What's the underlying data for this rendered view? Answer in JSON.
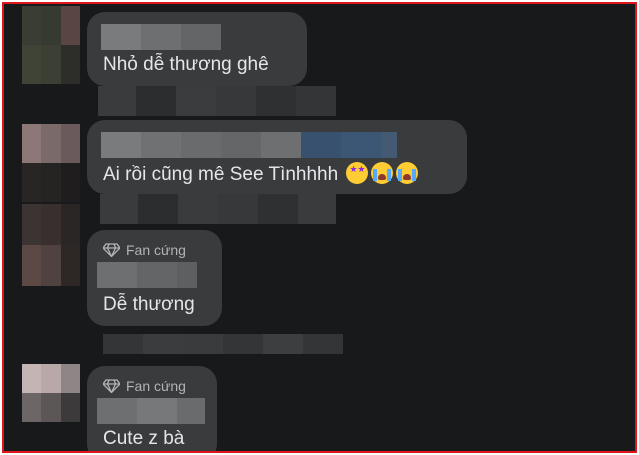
{
  "comments": [
    {
      "text": "Nhỏ dễ thương ghê",
      "badge": ""
    },
    {
      "text": "Ai rồi cũng mê See Tìnhhhh",
      "badge": ""
    },
    {
      "text": "Dễ thương",
      "badge": "Fan cứng"
    },
    {
      "text": "Cute z bà",
      "badge": "Fan cứng"
    }
  ],
  "icons": [
    "star-struck-emoji",
    "loudly-crying-emoji",
    "diamond-icon"
  ],
  "colors": {
    "background": "#18191a",
    "bubble": "#3a3b3c",
    "text": "#e4e6eb",
    "frame_border": "#e0161d",
    "badge_text": "#b0b3b8"
  }
}
